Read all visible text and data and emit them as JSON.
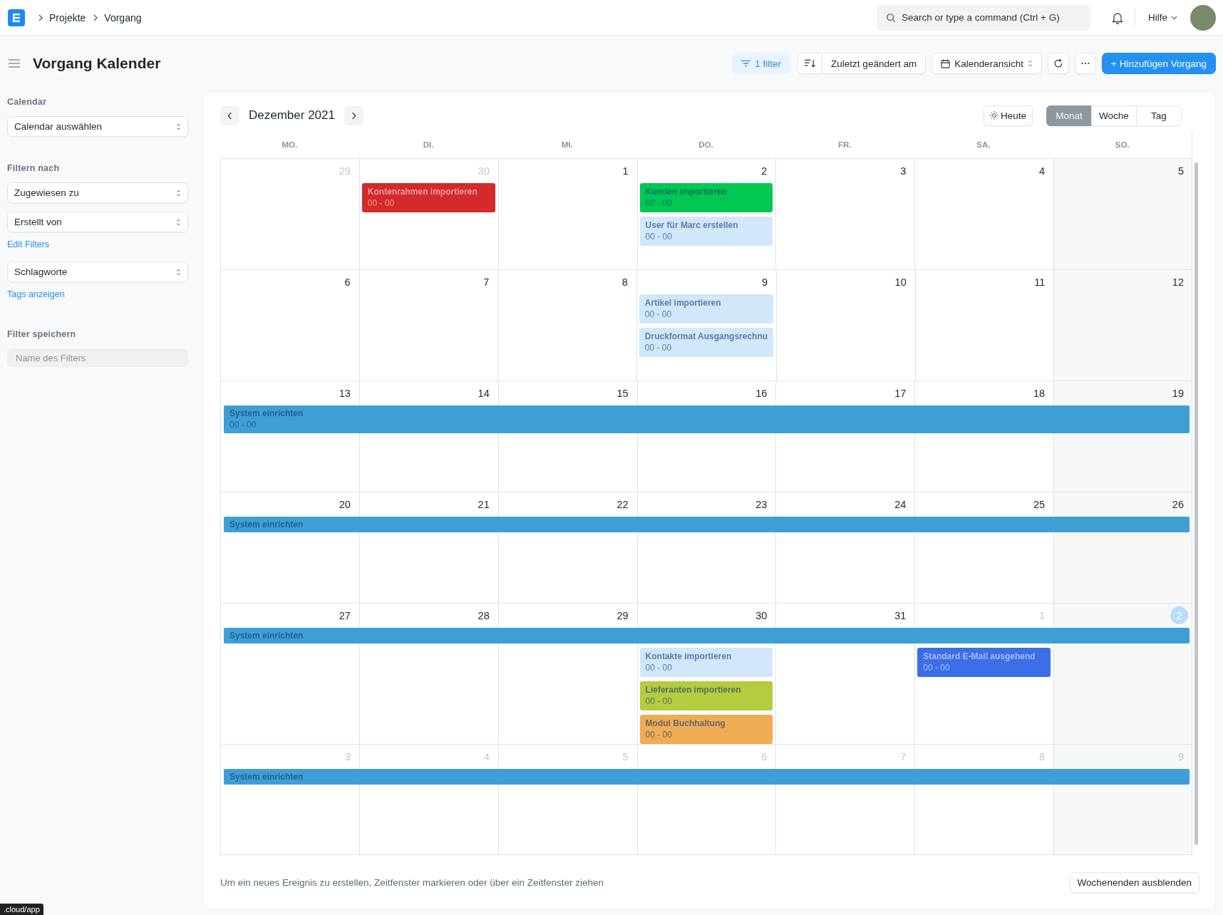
{
  "navbar": {
    "breadcrumbs": [
      "Projekte",
      "Vorgang"
    ],
    "search_placeholder": "Search or type a command (Ctrl + G)",
    "help": "Hilfe"
  },
  "page": {
    "title": "Vorgang Kalender"
  },
  "toolbar": {
    "filter": "1 filter",
    "sort": "Zuletzt geändert am",
    "view": "Kalenderansicht",
    "add": "+ Hinzufügen Vorgang"
  },
  "sidebar": {
    "calendar_label": "Calendar",
    "calendar_select": "Calendar auswählen",
    "filter_label": "Filtern nach",
    "filters": [
      "Zugewiesen zu",
      "Erstellt von"
    ],
    "edit_filters": "Edit Filters",
    "tags_select": "Schlagworte",
    "tags_link": "Tags anzeigen",
    "save_label": "Filter speichern",
    "save_placeholder": "Name des Filters"
  },
  "calendar": {
    "title": "Dezember 2021",
    "today_button": "Heute",
    "views": [
      {
        "label": "Monat",
        "selected": true
      },
      {
        "label": "Woche",
        "selected": false
      },
      {
        "label": "Tag",
        "selected": false
      }
    ],
    "weekdays": [
      "MO.",
      "DI.",
      "MI.",
      "DO.",
      "FR.",
      "SA.",
      "SO."
    ],
    "weeks": [
      {
        "days": [
          {
            "date": "29",
            "other_month": true,
            "today": false
          },
          {
            "date": "30",
            "other_month": true,
            "today": false,
            "events": [
              {
                "title": "Kontenrahmen importieren",
                "time": "00 - 00",
                "color": "#d42a2a"
              }
            ]
          },
          {
            "date": "1",
            "other_month": false,
            "today": false
          },
          {
            "date": "2",
            "other_month": false,
            "today": false,
            "events": [
              {
                "title": "Kunden importieren",
                "time": "00 - 00",
                "color": "#00c853"
              },
              {
                "title": "User für Marc erstellen",
                "time": "00 - 00",
                "color": "#d2e7fa"
              }
            ]
          },
          {
            "date": "3",
            "other_month": false,
            "today": false
          },
          {
            "date": "4",
            "other_month": false,
            "today": false
          },
          {
            "date": "5",
            "other_month": false,
            "today": false
          }
        ]
      },
      {
        "days": [
          {
            "date": "6",
            "other_month": false,
            "today": false
          },
          {
            "date": "7",
            "other_month": false,
            "today": false
          },
          {
            "date": "8",
            "other_month": false,
            "today": false
          },
          {
            "date": "9",
            "other_month": false,
            "today": false,
            "events": [
              {
                "title": "Artikel importieren",
                "time": "00 - 00",
                "color": "#d2e7fa"
              },
              {
                "title": "Druckformat Ausgangsrechnu",
                "time": "00 - 00",
                "color": "#d2e7fa"
              }
            ]
          },
          {
            "date": "10",
            "other_month": false,
            "today": false
          },
          {
            "date": "11",
            "other_month": false,
            "today": false
          },
          {
            "date": "12",
            "other_month": false,
            "today": false
          }
        ]
      },
      {
        "span_events": [
          {
            "title": "System einrichten",
            "time": "00 - 00",
            "color": "#3f9fd5"
          }
        ],
        "days": [
          {
            "date": "13",
            "other_month": false,
            "today": false
          },
          {
            "date": "14",
            "other_month": false,
            "today": false
          },
          {
            "date": "15",
            "other_month": false,
            "today": false
          },
          {
            "date": "16",
            "other_month": false,
            "today": false
          },
          {
            "date": "17",
            "other_month": false,
            "today": false
          },
          {
            "date": "18",
            "other_month": false,
            "today": false
          },
          {
            "date": "19",
            "other_month": false,
            "today": false
          }
        ]
      },
      {
        "span_events": [
          {
            "title": "System einrichten",
            "color": "#3f9fd5"
          }
        ],
        "days": [
          {
            "date": "20",
            "other_month": false,
            "today": false
          },
          {
            "date": "21",
            "other_month": false,
            "today": false
          },
          {
            "date": "22",
            "other_month": false,
            "today": false
          },
          {
            "date": "23",
            "other_month": false,
            "today": false
          },
          {
            "date": "24",
            "other_month": false,
            "today": false
          },
          {
            "date": "25",
            "other_month": false,
            "today": false
          },
          {
            "date": "26",
            "other_month": false,
            "today": false
          }
        ]
      },
      {
        "span_events": [
          {
            "title": "System einrichten",
            "color": "#3f9fd5"
          }
        ],
        "days": [
          {
            "date": "27",
            "other_month": false,
            "today": false
          },
          {
            "date": "28",
            "other_month": false,
            "today": false
          },
          {
            "date": "29",
            "other_month": false,
            "today": false
          },
          {
            "date": "30",
            "other_month": false,
            "today": false,
            "events": [
              {
                "title": "Kontakte importieren",
                "time": "00 - 00",
                "color": "#d2e7fa"
              },
              {
                "title": "Lieferanten importieren",
                "time": "00 - 00",
                "color": "#b5cc3f"
              },
              {
                "title": "Modul Buchhaltung",
                "time": "00 - 00",
                "color": "#f0ab55"
              }
            ]
          },
          {
            "date": "31",
            "other_month": false,
            "today": false
          },
          {
            "date": "1",
            "other_month": true,
            "today": false,
            "events": [
              {
                "title": "Standard E-Mail ausgehend",
                "time": "00 - 00",
                "color": "#3c6ee8"
              }
            ]
          },
          {
            "date": "2",
            "other_month": true,
            "today": true
          }
        ]
      },
      {
        "span_events": [
          {
            "title": "System einrichten",
            "color": "#3f9fd5"
          }
        ],
        "days": [
          {
            "date": "3",
            "other_month": true,
            "today": false
          },
          {
            "date": "4",
            "other_month": true,
            "today": false
          },
          {
            "date": "5",
            "other_month": true,
            "today": false
          },
          {
            "date": "6",
            "other_month": true,
            "today": false
          },
          {
            "date": "7",
            "other_month": true,
            "today": false
          },
          {
            "date": "8",
            "other_month": true,
            "today": false
          },
          {
            "date": "9",
            "other_month": true,
            "today": false
          }
        ]
      }
    ]
  },
  "footer": {
    "hint": "Um ein neues Ereignis zu erstellen, Zeitfenster markieren oder über ein Zeitfenster ziehen",
    "button": "Wochenenden ausblenden"
  },
  "status_url": ".cloud/app"
}
